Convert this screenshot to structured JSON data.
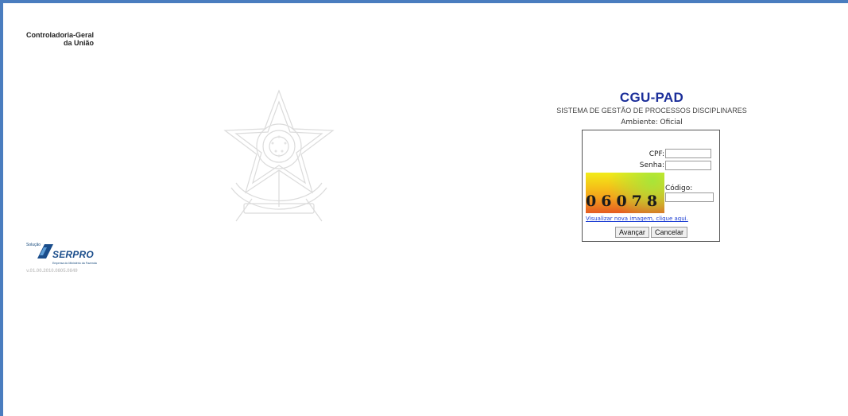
{
  "organization": {
    "line1": "Controladoria-Geral",
    "line2": "da União"
  },
  "app": {
    "title": "CGU-PAD",
    "subtitle": "SISTEMA DE GESTÃO DE PROCESSOS DISCIPLINARES",
    "environment": "Ambiente: Oficial"
  },
  "login": {
    "cpf_label": "CPF:",
    "cpf_value": "",
    "password_label": "Senha:",
    "password_value": "",
    "code_label": "Código:",
    "code_value": "",
    "captcha_text": "06078",
    "refresh_link": "Visualizar nova imagem, clique aqui.",
    "submit_label": "Avançar",
    "cancel_label": "Cancelar"
  },
  "serpro": {
    "solution_label": "Solução",
    "name": "SERPRO",
    "tagline": "Empresa do Ministério da Fazenda"
  },
  "version": "v.01.00.2010.0805.0849",
  "colors": {
    "frame": "#4a7dbf",
    "title": "#1c2f9a",
    "link": "#1b3dd3",
    "serpro": "#1a4d8b"
  },
  "icons": {
    "emblem": "brazil-coat-of-arms-watermark",
    "serpro_logo": "serpro-logo"
  }
}
